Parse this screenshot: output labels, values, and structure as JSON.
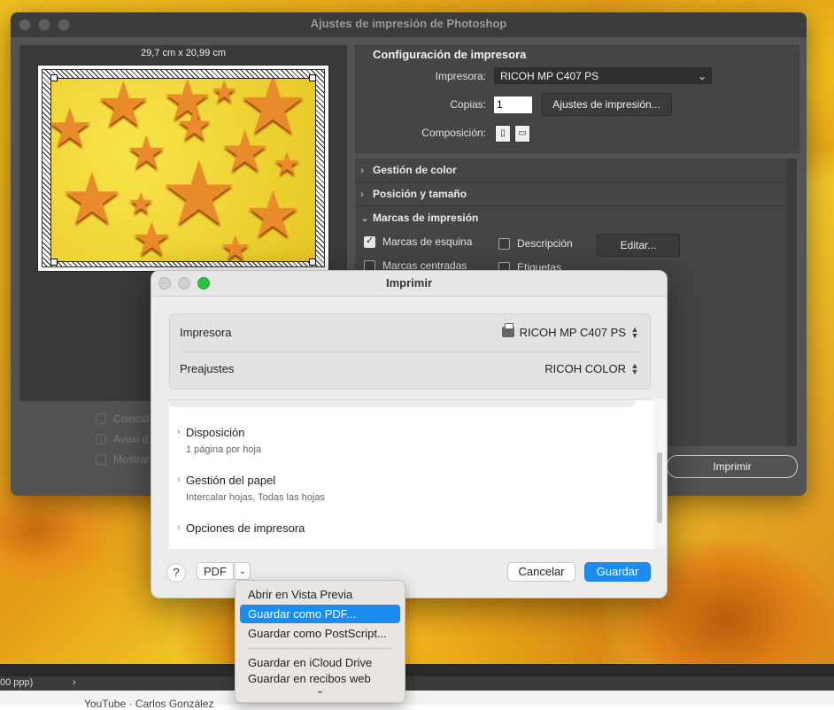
{
  "photoshop": {
    "title": "Ajustes de impresión de Photoshop",
    "paper_size": "29,7 cm x 20,99 cm",
    "left_checkboxes": [
      "Coincid",
      "Aviso d",
      "Mostrar"
    ],
    "printer_config": {
      "heading": "Configuración de impresora",
      "printer_label": "Impresora:",
      "printer_value": "RICOH MP C407 PS",
      "copies_label": "Copias:",
      "copies_value": "1",
      "print_settings_button": "Ajustes de impresión...",
      "layout_label": "Composición:"
    },
    "sections": {
      "color": "Gestión de color",
      "position": "Posición y tamaño",
      "marks": "Marcas de impresión"
    },
    "marks_options": {
      "corner": "Marcas de esquina",
      "description": "Descripción",
      "edit_button": "Editar...",
      "center": "Marcas centradas",
      "labels": "Etiquetas"
    },
    "print_button": "Imprimir"
  },
  "print_dialog": {
    "title": "Imprimir",
    "printer_label": "Impresora",
    "printer_value": "RICOH MP C407 PS",
    "presets_label": "Preajustes",
    "presets_value": "RICOH COLOR",
    "items": [
      {
        "label": "Disposición",
        "sub": "1 página por hoja"
      },
      {
        "label": "Gestión del papel",
        "sub": "Intercalar hojas, Todas las hojas"
      },
      {
        "label": "Opciones de impresora",
        "sub": ""
      }
    ],
    "help": "?",
    "pdf_button": "PDF",
    "cancel": "Cancelar",
    "save": "Guardar"
  },
  "pdf_menu": {
    "items": [
      "Abrir en Vista Previa",
      "Guardar como PDF...",
      "Guardar como PostScript...",
      "Guardar en iCloud Drive",
      "Guardar en recibos web"
    ],
    "selected": "Guardar como PDF..."
  },
  "taskbar": {
    "zoom_text": "00 ppp)",
    "arrow": "›",
    "channel_text": "YouTube · Carlos González"
  }
}
